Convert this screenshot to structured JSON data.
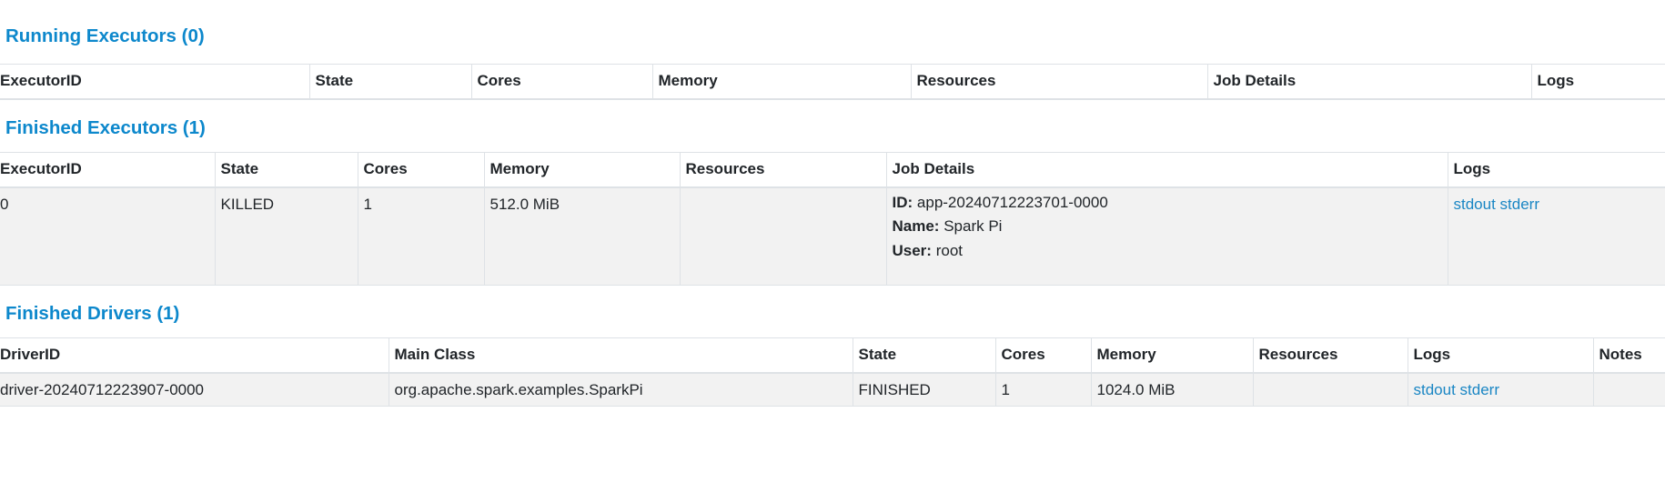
{
  "running_executors": {
    "title": "Running Executors (0)",
    "columns": [
      "ExecutorID",
      "State",
      "Cores",
      "Memory",
      "Resources",
      "Job Details",
      "Logs"
    ]
  },
  "finished_executors": {
    "title": "Finished Executors (1)",
    "columns": [
      "ExecutorID",
      "State",
      "Cores",
      "Memory",
      "Resources",
      "Job Details",
      "Logs"
    ],
    "rows": [
      {
        "executor_id": "0",
        "state": "KILLED",
        "cores": "1",
        "memory": "512.0 MiB",
        "resources": "",
        "job_details": {
          "id_key": "ID:",
          "id_value": "app-20240712223701-0000",
          "name_key": "Name:",
          "name_value": "Spark Pi",
          "user_key": "User:",
          "user_value": "root"
        },
        "logs": {
          "stdout": "stdout",
          "stderr": "stderr"
        }
      }
    ]
  },
  "finished_drivers": {
    "title": "Finished Drivers (1)",
    "columns": [
      "DriverID",
      "Main Class",
      "State",
      "Cores",
      "Memory",
      "Resources",
      "Logs",
      "Notes"
    ],
    "rows": [
      {
        "driver_id": "driver-20240712223907-0000",
        "main_class": "org.apache.spark.examples.SparkPi",
        "state": "FINISHED",
        "cores": "1",
        "memory": "1024.0 MiB",
        "resources": "",
        "logs": {
          "stdout": "stdout",
          "stderr": "stderr"
        },
        "notes": ""
      }
    ]
  },
  "colors": {
    "heading": "#0d88cc",
    "link": "#1a86c4",
    "row_background": "#f2f2f2",
    "border": "#dee2e6"
  }
}
